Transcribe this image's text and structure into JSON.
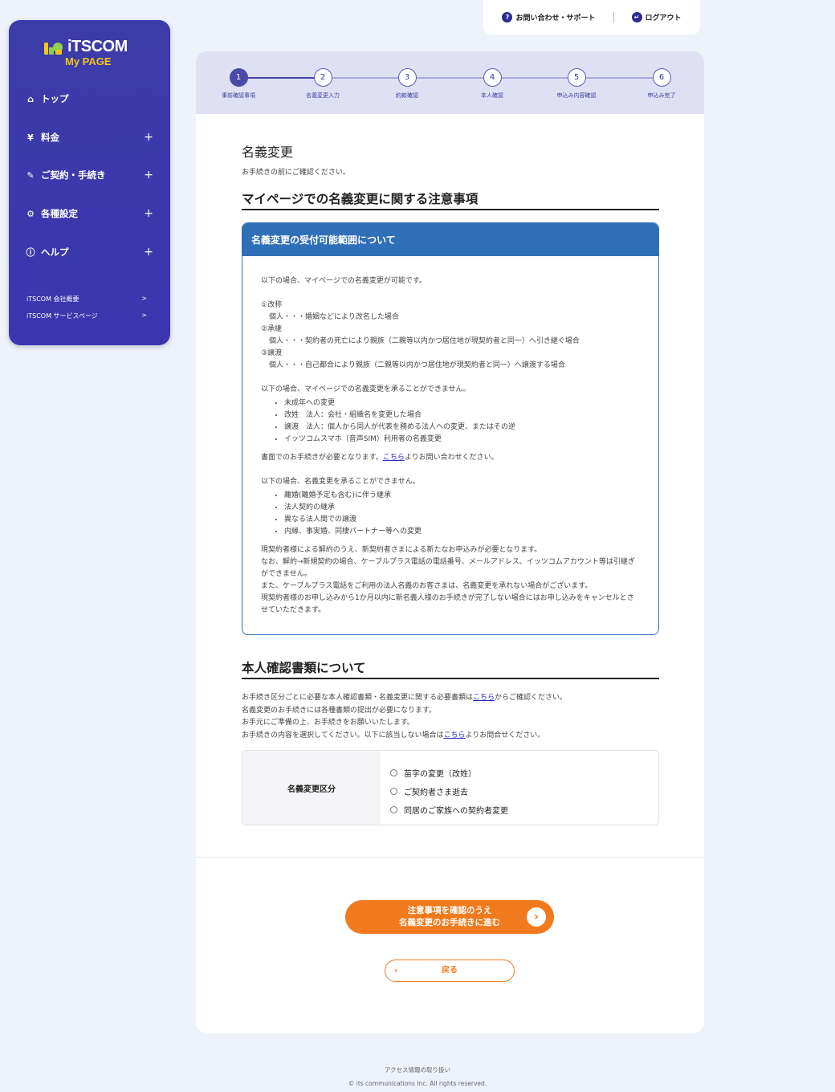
{
  "topbar": {
    "support_label": "お問い合わせ・サポート",
    "logout_label": "ログアウト"
  },
  "sidebar": {
    "brand": "iTSCOM",
    "brand_sub": "My PAGE",
    "items": [
      {
        "label": "トップ",
        "icon": "home-icon"
      },
      {
        "label": "料金",
        "icon": "yen-icon"
      },
      {
        "label": "ご契約・手続き",
        "icon": "pen-icon"
      },
      {
        "label": "各種設定",
        "icon": "gear-icon"
      },
      {
        "label": "ヘルプ",
        "icon": "help-icon"
      }
    ],
    "links": [
      {
        "label": "iTSCOM 会社概要"
      },
      {
        "label": "iTSCOM サービスページ"
      }
    ]
  },
  "stepper": {
    "current": 1,
    "steps": [
      {
        "num": "1",
        "label": "事前確認事項"
      },
      {
        "num": "2",
        "label": "名義変更入力"
      },
      {
        "num": "3",
        "label": "約款確認"
      },
      {
        "num": "4",
        "label": "本人確認"
      },
      {
        "num": "5",
        "label": "申込み内容確認"
      },
      {
        "num": "6",
        "label": "申込み完了"
      }
    ]
  },
  "main": {
    "title": "名義変更",
    "subtitle": "お手続きの前にご確認ください。",
    "section1_title": "マイページでの名義変更に関する注意事項",
    "notice": {
      "heading": "名義変更の受付可能範囲について",
      "intro": "以下の場合、マイページでの名義変更が可能です。",
      "cases": [
        {
          "title": "①改称",
          "desc": "個人・・・婚姻などにより改名した場合"
        },
        {
          "title": "②承継",
          "desc": "個人・・・契約者の死亡により親族（二親等以内かつ居住地が現契約者と同一）へ引き継ぐ場合"
        },
        {
          "title": "③譲渡",
          "desc": "個人・・・自己都合により親族（二親等以内かつ居住地が現契約者と同一）へ譲渡する場合"
        }
      ],
      "not_possible_intro": "以下の場合、マイページでの名義変更を承ることができません。",
      "not_possible": [
        "未成年への変更",
        "改姓　法人：会社・組織名を変更した場合",
        "譲渡　法人：個人から同人が代表を務める法人への変更、またはその逆",
        "イッツコムスマホ（音声SIM）利用者の名義変更"
      ],
      "paper_before": "書面でのお手続きが必要となります。",
      "paper_link": "こちら",
      "paper_after": "よりお問い合わせください。",
      "refused_intro": "以下の場合、名義変更を承ることができません。",
      "refused": [
        "離婚(離婚予定も含む)に伴う継承",
        "法人契約の継承",
        "異なる法人間での譲渡",
        "内縁、事実婚、同棲パートナー等への変更"
      ],
      "notes": [
        "現契約者様による解約のうえ、新契約者さまによる新たなお申込みが必要となります。",
        "なお、解約→新規契約の場合、ケーブルプラス電話の電話番号、メールアドレス、イッツコムアカウント等は引継ぎができません。",
        "また、ケーブルプラス電話をご利用の法人名義のお客さまは、名義変更を承れない場合がございます。",
        "現契約者様のお申し込みから1か月以内に新名義人様のお手続きが完了しない場合にはお申し込みをキャンセルとさせていただきます。"
      ]
    },
    "section2_title": "本人確認書類について",
    "intro_lines": {
      "l1_before": "お手続き区分ごとに必要な本人確認書類・名義変更に関する必要書類は",
      "l1_link": "こちら",
      "l1_after": "からご確認ください。",
      "l2": "名義変更のお手続きには各種書類の提出が必要になります。",
      "l3": "お手元にご準備の上、お手続きをお願いいたします。",
      "l4_before": "お手続きの内容を選択してください。以下に該当しない場合は",
      "l4_link": "こちら",
      "l4_after": "よりお問合せください。"
    },
    "choice": {
      "label": "名義変更区分",
      "options": [
        "苗字の変更（改姓）",
        "ご契約者さま逝去",
        "同居のご家族への契約者変更"
      ]
    },
    "primary_button": {
      "line1": "注意事項を確認のうえ",
      "line2": "名義変更のお手続きに進む"
    },
    "back_button": "戻る"
  },
  "footer": {
    "access": "アクセス情報の取り扱い",
    "copyright": "© its communications Inc. All rights reserved."
  },
  "colors": {
    "sidebar": "#3a38aa",
    "accent_orange": "#f07a1d",
    "notice_blue": "#2f6fb8",
    "logo_yellow": "#f5c518"
  }
}
